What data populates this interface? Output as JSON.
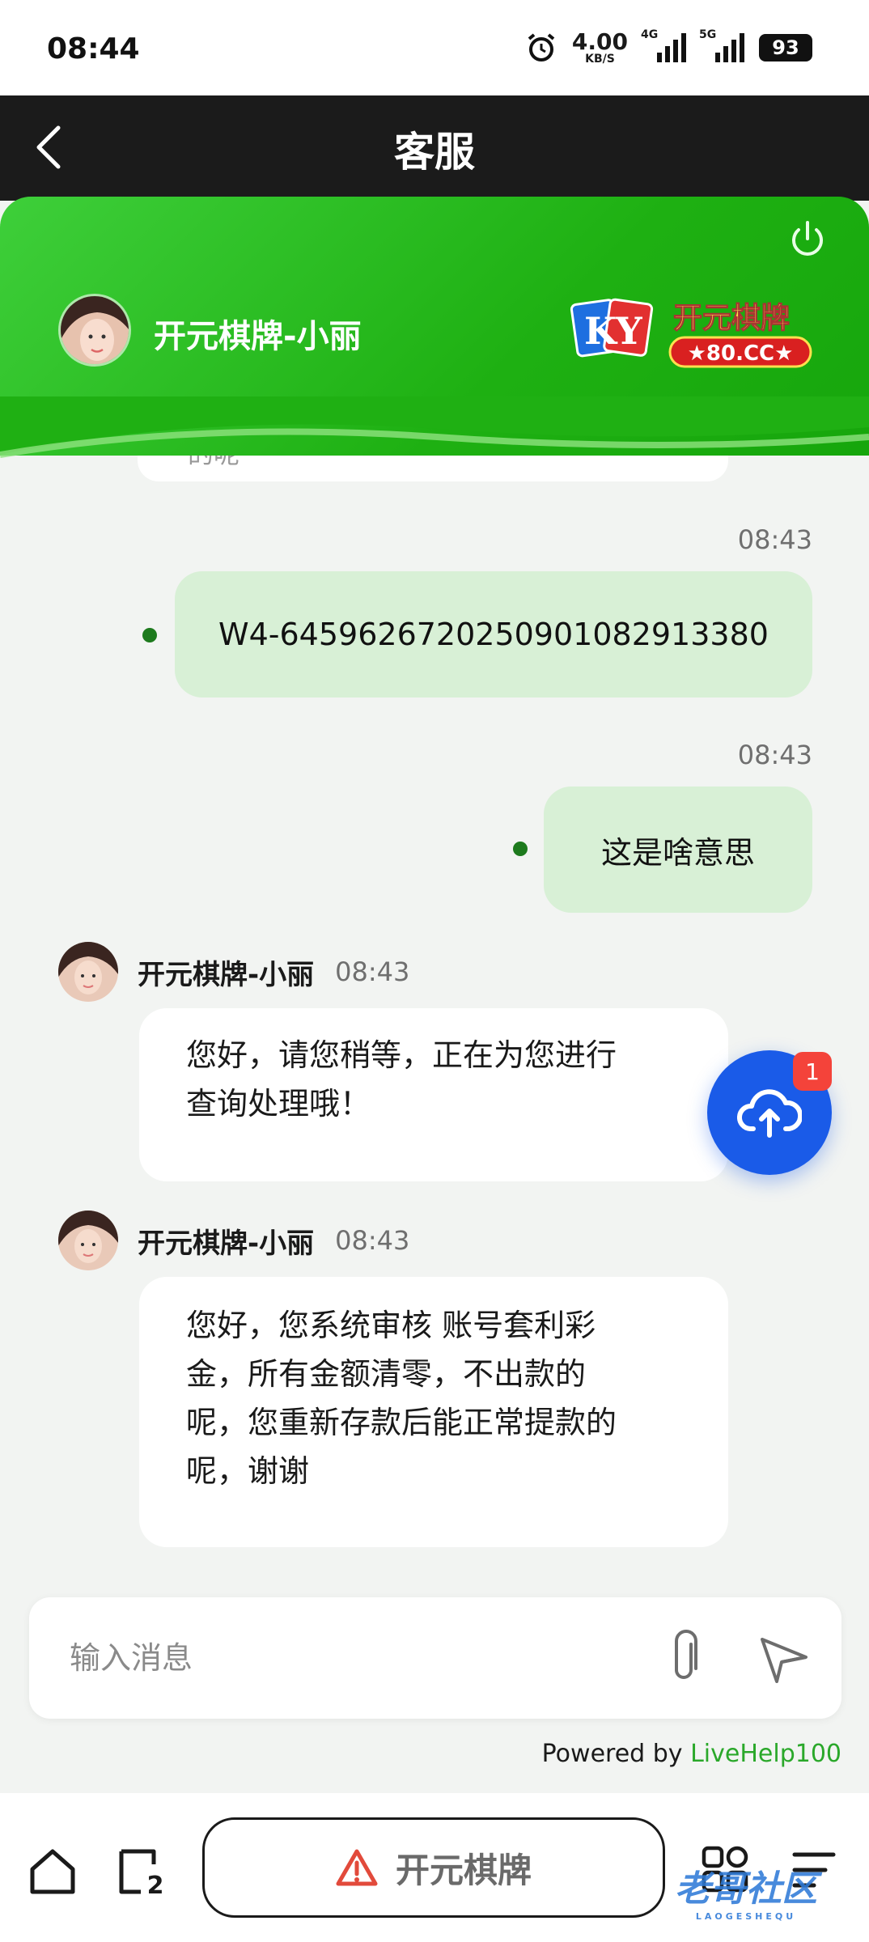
{
  "status_bar": {
    "time": "08:44",
    "speed_value": "4.00",
    "speed_unit": "KB/S",
    "network_1": "4G",
    "network_2": "5G",
    "battery": "93"
  },
  "header": {
    "title": "客服"
  },
  "agent": {
    "name": "开元棋牌-小丽",
    "logo_letters": "KY",
    "logo_name": "开元棋牌",
    "logo_domain": "★80.CC★"
  },
  "messages": {
    "prev_partial_text": "的呢",
    "outgoing": [
      {
        "time": "08:43",
        "text": "W4-64596267202509010829133​80"
      },
      {
        "time": "08:43",
        "text": "这是啥意思"
      }
    ],
    "incoming": [
      {
        "name": "开元棋牌-小丽",
        "time": "08:43",
        "line1": "您好，请您稍等，正在为您进行",
        "line2": "查询处理哦！"
      },
      {
        "name": "开元棋牌-小丽",
        "time": "08:43",
        "line1": "您好，您系统审核 账号套利彩",
        "line2": "金，所有金额清零，不出款的",
        "line3": "呢，您重新存款后能正常提款的",
        "line4": "呢，谢谢"
      }
    ]
  },
  "upload_badge": "1",
  "composer": {
    "placeholder": "输入消息"
  },
  "powered": {
    "prefix": "Powered by ",
    "brand": "LiveHelp100"
  },
  "bottom_nav": {
    "tab_count": "2",
    "pill_label": "开元棋牌",
    "watermark": "老哥社区",
    "watermark_sub": "LAOGESHEQU"
  },
  "colors": {
    "header_green": "#1eb012",
    "bubble_out": "#d8f0d6",
    "fab_blue": "#1a5be8",
    "badge_red": "#f4433a",
    "brand_green": "#2aa82a"
  }
}
